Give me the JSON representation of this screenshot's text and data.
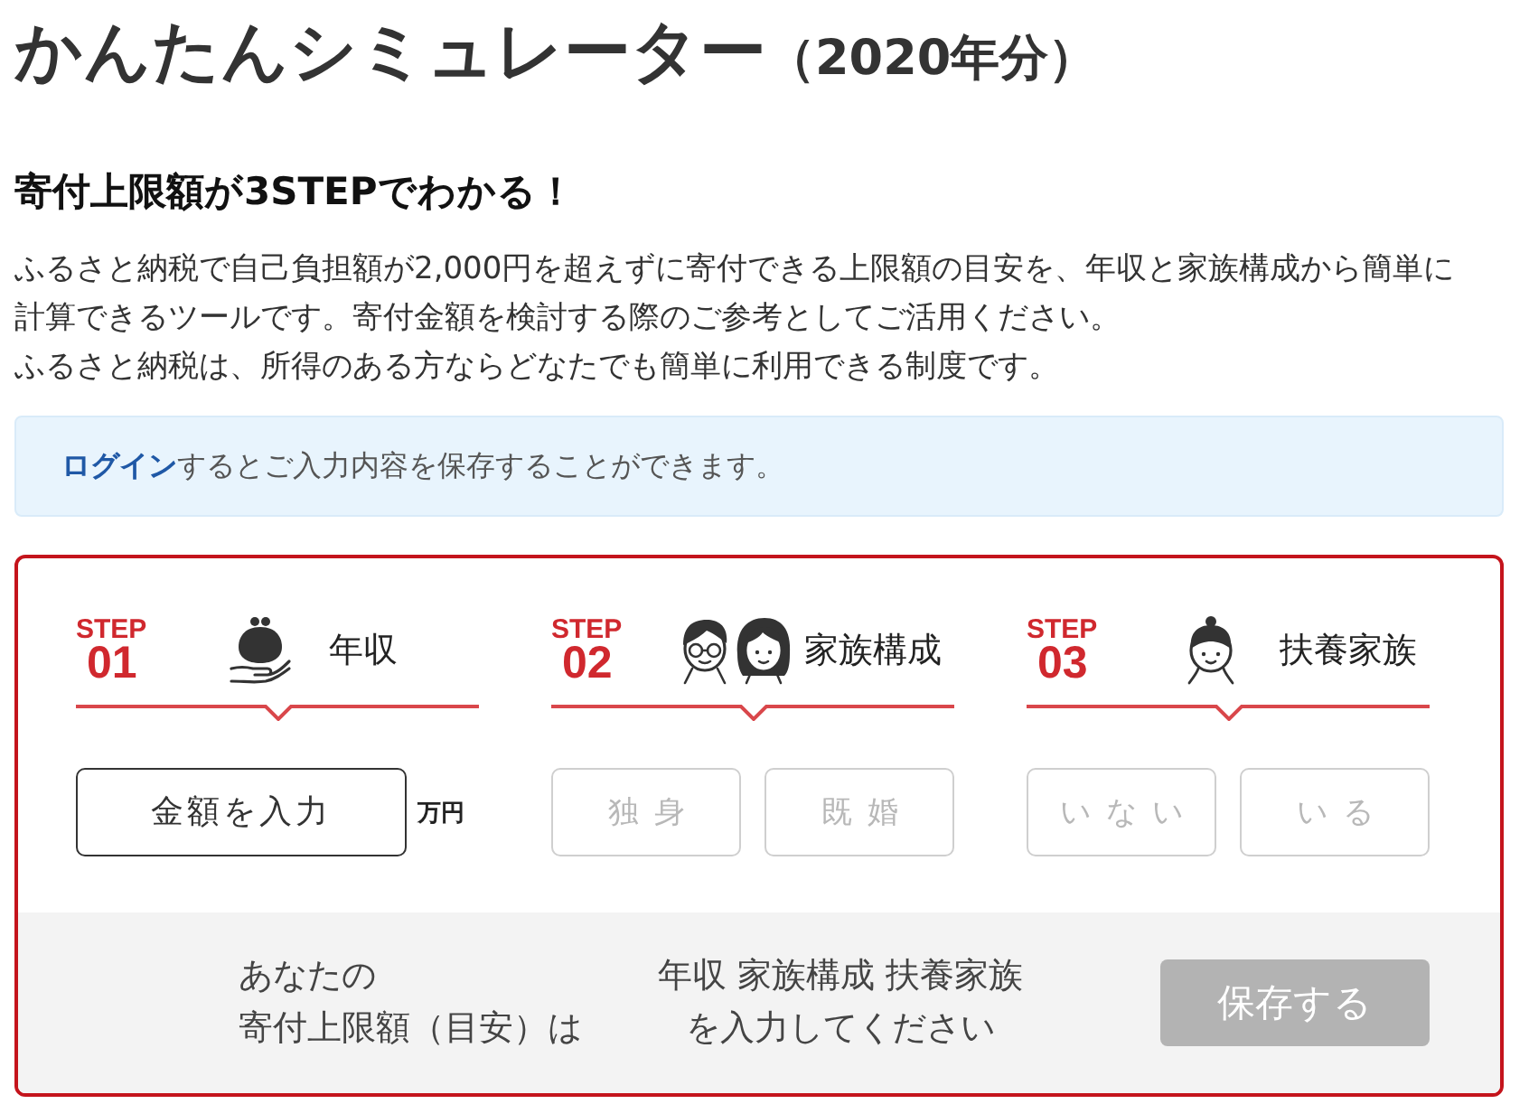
{
  "title": "かんたんシミュレーター",
  "title_suffix": "（2020年分）",
  "heading": "寄付上限額が3STEPでわかる！",
  "description": [
    "ふるさと納税で自己負担額が2,000円を超えずに寄付できる上限額の目安を、年収と家族構成から簡単に計算できるツールです。寄付金額を検討する際のご参考としてご活用ください。",
    "ふるさと納税は、所得のある方ならどなたでも簡単に利用できる制度です。"
  ],
  "login_notice": {
    "link": "ログイン",
    "text": "するとご入力内容を保存することができます。"
  },
  "steps": [
    {
      "badge": "STEP",
      "number": "01",
      "label": "年収",
      "kind": "amount",
      "field": {
        "placeholder": "金額を入力",
        "unit": "万円"
      }
    },
    {
      "badge": "STEP",
      "number": "02",
      "label": "家族構成",
      "kind": "choice",
      "options": [
        {
          "label": "独身",
          "selected": false,
          "disabled": true
        },
        {
          "label": "既婚",
          "selected": false,
          "disabled": true
        }
      ]
    },
    {
      "badge": "STEP",
      "number": "03",
      "label": "扶養家族",
      "kind": "choice",
      "options": [
        {
          "label": "いない",
          "selected": false,
          "disabled": true
        },
        {
          "label": "いる",
          "selected": false,
          "disabled": true
        }
      ]
    }
  ],
  "result": {
    "label_lines": [
      "あなたの",
      "寄付上限額（目安）は"
    ],
    "message_lines": [
      "年収 家族構成 扶養家族",
      "を入力してください"
    ],
    "save_button": {
      "label": "保存する",
      "disabled": true
    }
  }
}
